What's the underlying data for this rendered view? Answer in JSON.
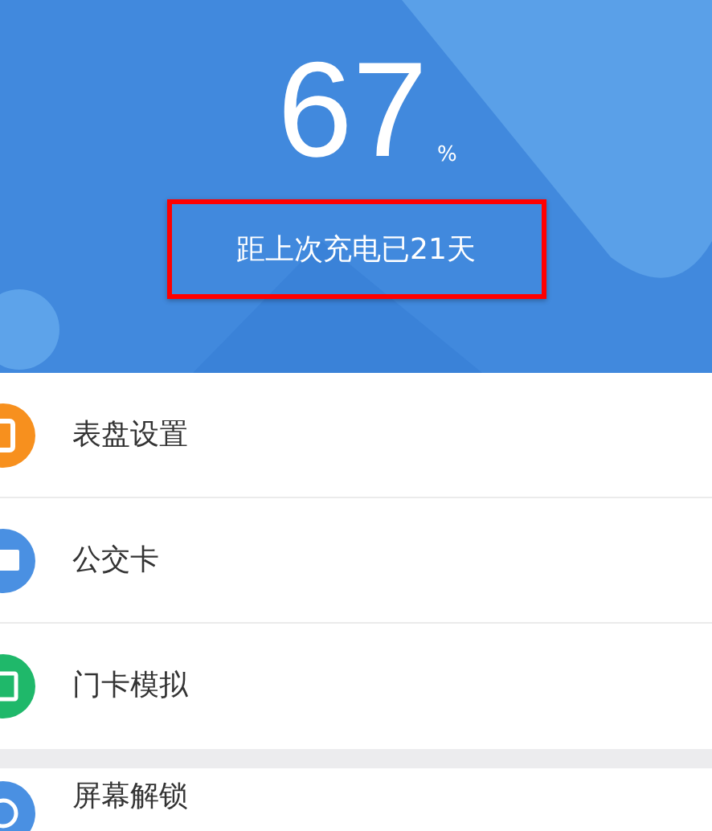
{
  "battery": {
    "value": "67",
    "unit": "%",
    "since_charge": "距上次充电已21天"
  },
  "menu_groups": [
    {
      "items": [
        {
          "label": "表盘设置",
          "kind": "watch",
          "color": "#f7901e"
        },
        {
          "label": "公交卡",
          "kind": "bus",
          "color": "#4a90e2"
        },
        {
          "label": "门卡模拟",
          "kind": "door",
          "color": "#1fb86a"
        }
      ]
    },
    {
      "items": [
        {
          "label": "屏幕解锁",
          "kind": "lock",
          "color": "#4a90e2"
        }
      ]
    }
  ]
}
